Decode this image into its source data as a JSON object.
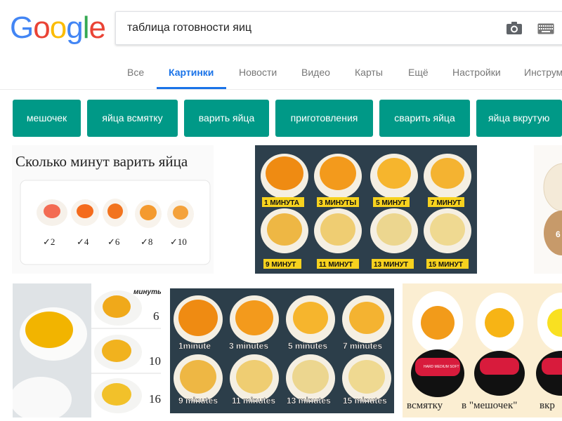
{
  "logo": {
    "letters": [
      "G",
      "o",
      "o",
      "g",
      "l",
      "e"
    ],
    "colors": [
      "#4285F4",
      "#EA4335",
      "#FBBC05",
      "#4285F4",
      "#34A853",
      "#EA4335"
    ]
  },
  "search": {
    "value": "таблица готовности яиц",
    "camera_icon": "camera-icon",
    "keyboard_icon": "keyboard-icon"
  },
  "tabs": [
    {
      "label": "Все",
      "active": false
    },
    {
      "label": "Картинки",
      "active": true
    },
    {
      "label": "Новости",
      "active": false
    },
    {
      "label": "Видео",
      "active": false
    },
    {
      "label": "Карты",
      "active": false
    },
    {
      "label": "Ещё",
      "active": false
    },
    {
      "label": "Настройки",
      "active": false
    },
    {
      "label": "Инструменты",
      "active": false
    }
  ],
  "chips": [
    "мешочек",
    "яйца всмятку",
    "варить яйца",
    "приготовления",
    "сварить яйца",
    "яйца вкрутую"
  ],
  "accent": "#1a73e8",
  "chip_color": "#009987",
  "results": {
    "r1": {
      "title": "Сколько минут варить яйца",
      "labels": [
        "✓2",
        "✓4",
        "✓6",
        "✓8",
        "✓10"
      ]
    },
    "r2": {
      "labels_top": [
        "1 МИНУТА",
        "3 МИНУТЫ",
        "5 МИНУТ",
        "7 МИНУТ"
      ],
      "labels_bottom": [
        "9 МИНУТ",
        "11 МИНУТ",
        "13 МИНУТ",
        "15 МИНУТ"
      ]
    },
    "r4": {
      "header": "минуты:",
      "labels": [
        "6",
        "10",
        "16"
      ]
    },
    "r5": {
      "labels_top": [
        "1minute",
        "3 minutes",
        "5 minutes",
        "7 minutes"
      ],
      "labels_bottom": [
        "9 minutes",
        "11 minutes",
        "13 minutes",
        "15 minutes"
      ]
    },
    "r6": {
      "labels": [
        "всмятку",
        "в \"мешочек\"",
        "вкр"
      ],
      "timer_text": "HARD MEDIUM SOFT"
    }
  }
}
